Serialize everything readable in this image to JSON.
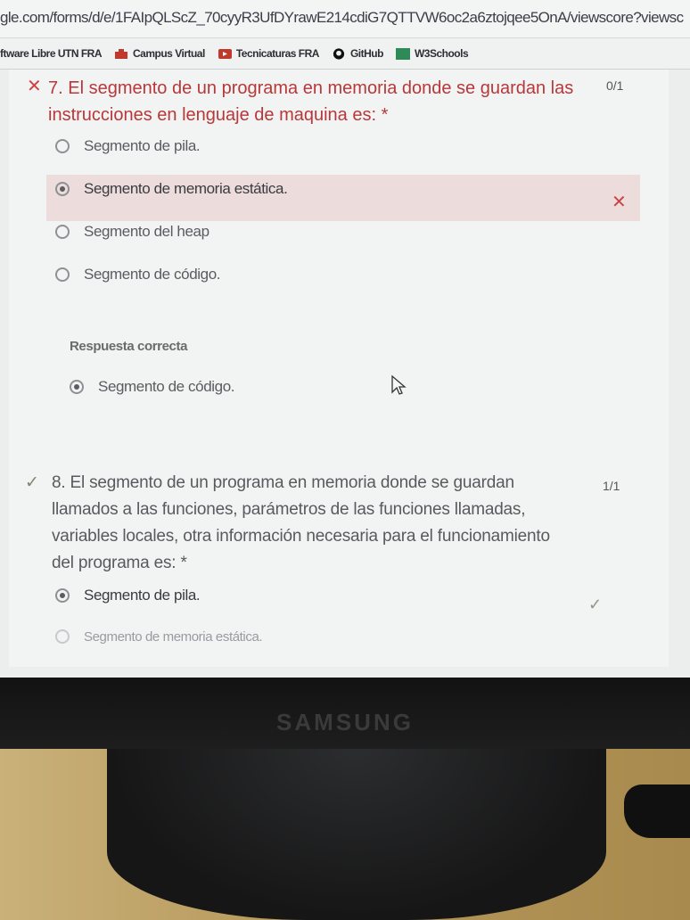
{
  "browser": {
    "url": "gle.com/forms/d/e/1FAIpQLScZ_70cyyR3UfDYrawE214cdiG7QTTVW6oc2a6ztojqee5OnA/viewscore?viewsc",
    "bookmarks": [
      {
        "label": "ftware Libre UTN FRA",
        "icon": "bookmark-icon"
      },
      {
        "label": "Campus Virtual",
        "icon": "campus-icon"
      },
      {
        "label": "Tecnicaturas FRA",
        "icon": "folder-icon"
      },
      {
        "label": "GitHub",
        "icon": "github-icon"
      },
      {
        "label": "W3Schools",
        "icon": "w3schools-icon"
      }
    ]
  },
  "q7": {
    "mark": "✕",
    "title": "7. El segmento de un programa en memoria donde se guardan las instrucciones en lenguaje de maquina es: *",
    "score": "0/1",
    "options": [
      {
        "label": "Segmento de pila.",
        "selected": false
      },
      {
        "label": "Segmento de memoria estática.",
        "selected": true
      },
      {
        "label": "Segmento del heap",
        "selected": false
      },
      {
        "label": "Segmento de código.",
        "selected": false
      }
    ],
    "wrong_mark": "✕",
    "correct_label": "Respuesta correcta",
    "correct_answer": "Segmento de código."
  },
  "q8": {
    "mark": "✓",
    "title": "8. El segmento de un programa en memoria donde se guardan llamados a las funciones, parámetros de las funciones llamadas, variables locales, otra información necesaria para el funcionamiento del programa es: *",
    "score": "1/1",
    "options": [
      {
        "label": "Segmento de pila.",
        "selected": true
      },
      {
        "label": "Segmento de memoria estática.",
        "selected": false
      }
    ],
    "check_mark": "✓"
  },
  "monitor": {
    "brand": "SAMSUNG"
  }
}
